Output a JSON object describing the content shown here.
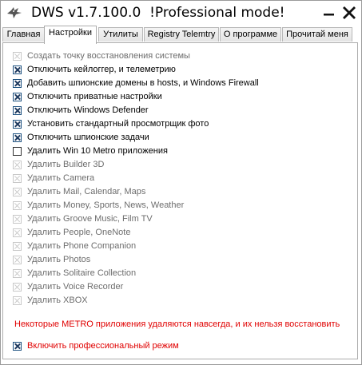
{
  "window": {
    "title": "DWS v1.7.100.0  !Professional mode!",
    "min_icon": "minimize-icon",
    "close_icon": "close-icon",
    "app_icon": "bird-logo-icon"
  },
  "tabs": [
    {
      "label": "Главная"
    },
    {
      "label": "Настройки"
    },
    {
      "label": "Утилиты"
    },
    {
      "label": "Registry Telemtry"
    },
    {
      "label": "О программе"
    },
    {
      "label": "Прочитай меня"
    }
  ],
  "active_tab": "Настройки",
  "options": [
    {
      "label": "Создать точку восстановления системы",
      "state": "disabled"
    },
    {
      "label": "Отключить кейлоггер, и телеметрию",
      "state": "checked"
    },
    {
      "label": "Добавить шпионские домены в hosts, и Windows Firewall",
      "state": "checked"
    },
    {
      "label": "Отключить приватные настройки",
      "state": "checked"
    },
    {
      "label": "Отключить Windows Defender",
      "state": "checked"
    },
    {
      "label": "Установить стандартный просмотрщик фото",
      "state": "checked"
    },
    {
      "label": "Отключить шпионские задачи",
      "state": "checked"
    },
    {
      "label": "Удалить Win 10 Metro приложения",
      "state": "unchecked"
    },
    {
      "label": "Удалить Builder 3D",
      "state": "disabled"
    },
    {
      "label": "Удалить Camera",
      "state": "disabled"
    },
    {
      "label": "Удалить Mail, Calendar, Maps",
      "state": "disabled"
    },
    {
      "label": "Удалить Money, Sports, News, Weather",
      "state": "disabled"
    },
    {
      "label": "Удалить Groove Music, Film TV",
      "state": "disabled"
    },
    {
      "label": "Удалить People, OneNote",
      "state": "disabled"
    },
    {
      "label": "Удалить Phone Companion",
      "state": "disabled"
    },
    {
      "label": "Удалить Photos",
      "state": "disabled"
    },
    {
      "label": "Удалить Solitaire Collection",
      "state": "disabled"
    },
    {
      "label": "Удалить Voice Recorder",
      "state": "disabled"
    },
    {
      "label": "Удалить XBOX",
      "state": "disabled"
    }
  ],
  "warning": "Некоторые METRO приложения удаляются навсегда, и их нельзя восстановить",
  "pro_mode": {
    "label": "Включить профессиональный режим",
    "state": "checked"
  },
  "colors": {
    "warning": "#e00000",
    "check": "#1e3a5f"
  }
}
